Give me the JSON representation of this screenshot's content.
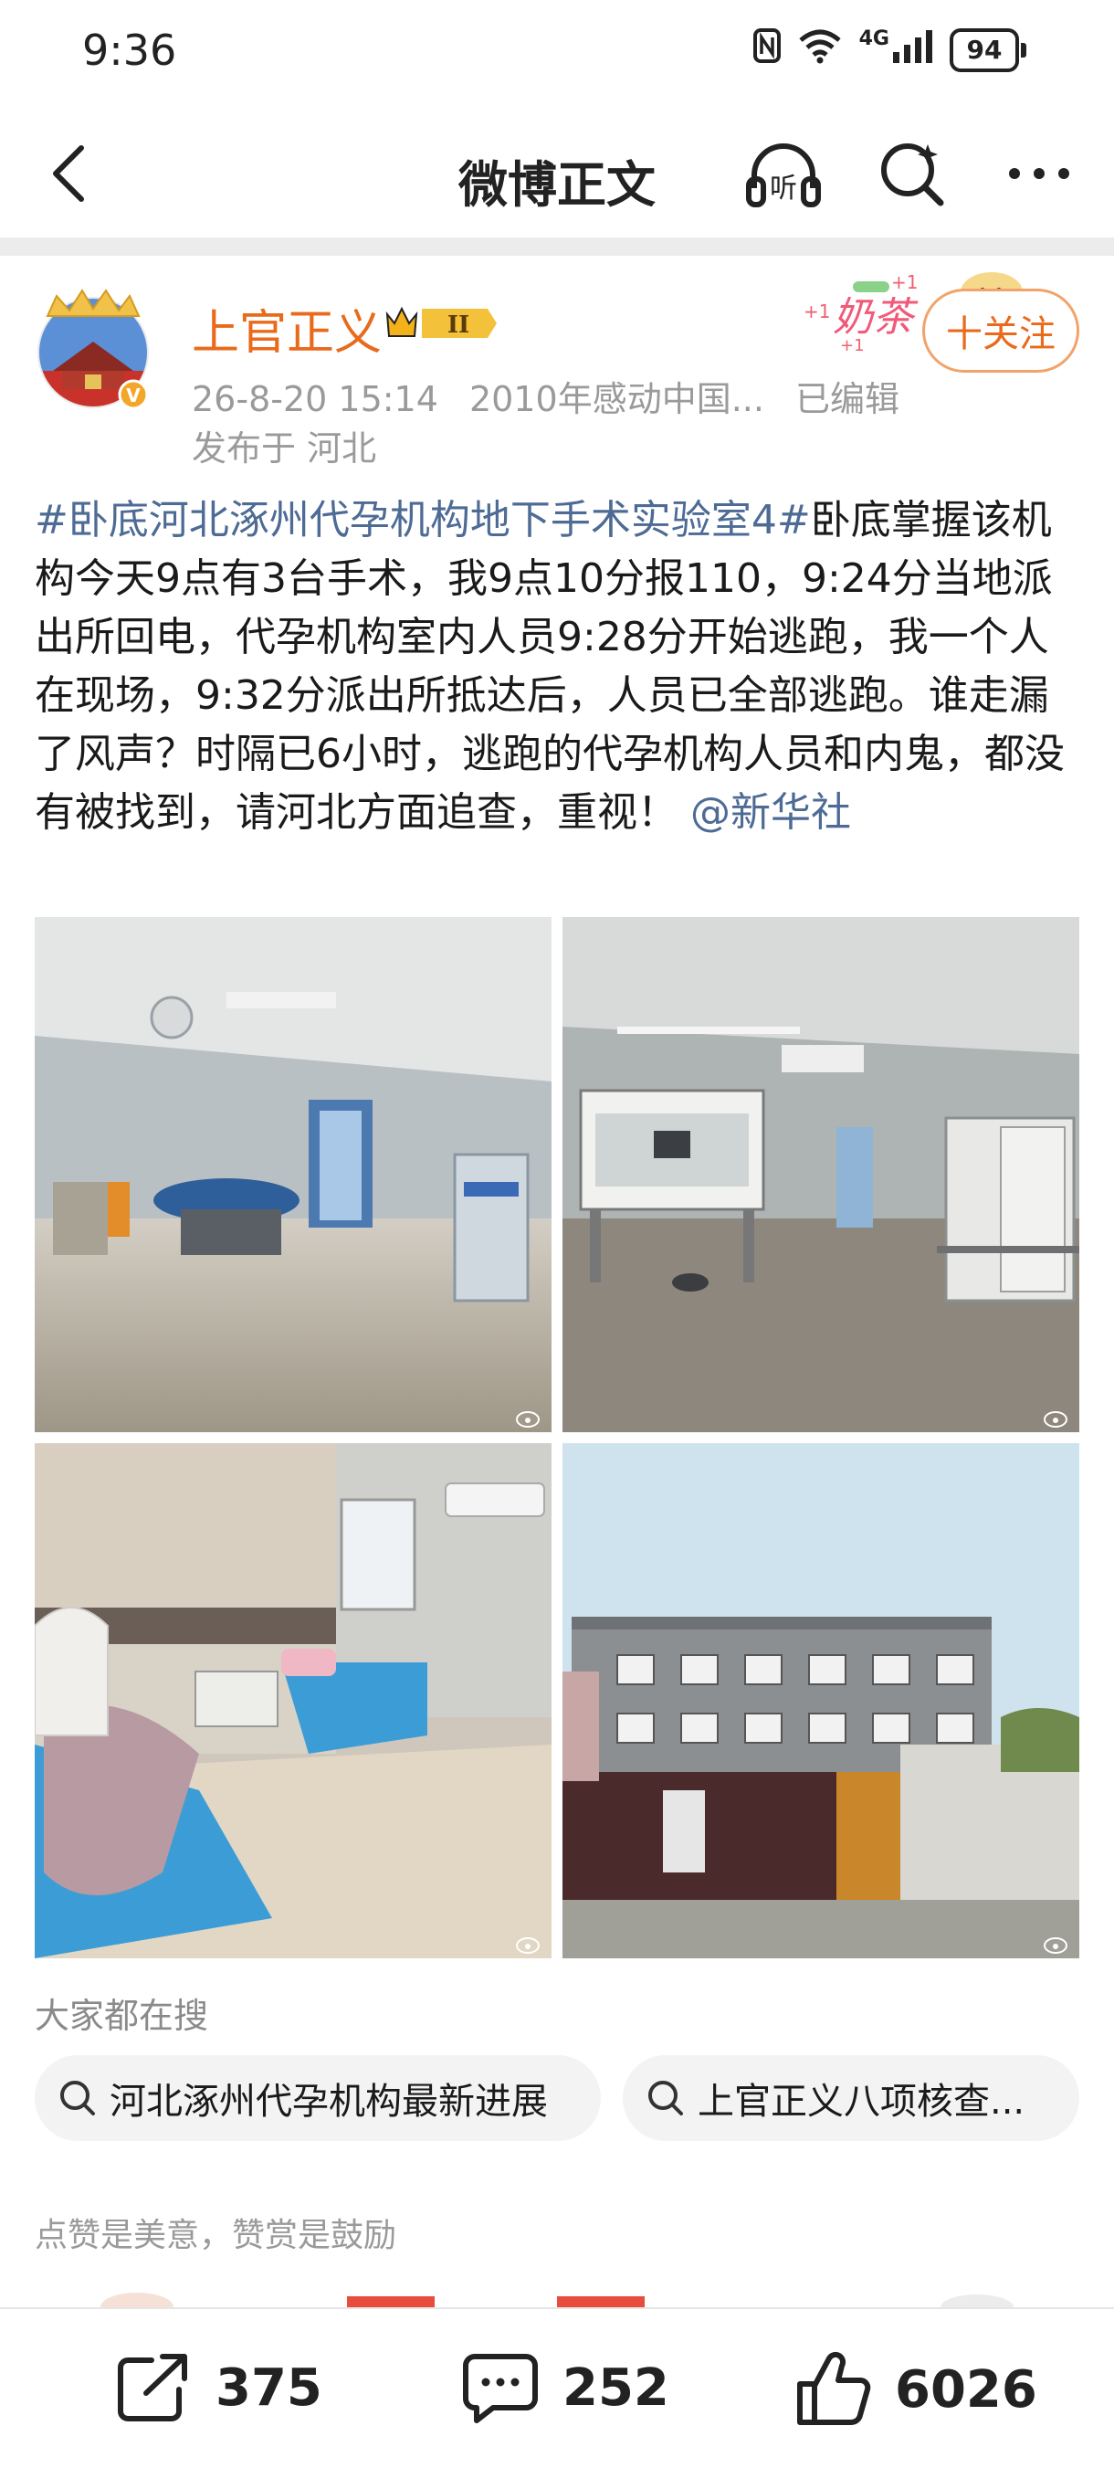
{
  "status": {
    "time": "9:36",
    "network": "4G",
    "battery": "94"
  },
  "nav": {
    "title": "微博正文"
  },
  "author": {
    "name": "上官正义",
    "level": "II",
    "follow_label": "十关注",
    "decor_text": "奶茶"
  },
  "post": {
    "date": "26-8-20 15:14",
    "source": "2010年感动中国...",
    "edited": "已编辑",
    "location": "发布于 河北",
    "hashtag": "#卧底河北涿州代孕机构地下手术实验室4#",
    "body": "卧底掌握该机构今天9点有3台手术，我9点10分报110，9:24分当地派出所回电，代孕机构室内人员9:28分开始逃跑，我一个人在现场，9:32分派出所抵达后，人员已全部逃跑。谁走漏了风声？时隔已6小时，逃跑的代孕机构人员和内鬼，都没有被找到，请河北方面追查，重视！",
    "mention": "@新华社"
  },
  "search": {
    "label": "大家都在搜",
    "chips": [
      "河北涿州代孕机构最新进展",
      "上官正义八项核查..."
    ]
  },
  "reward": {
    "label": "点赞是美意，赞赏是鼓励"
  },
  "actions": {
    "share": "375",
    "comment": "252",
    "like": "6026"
  },
  "colors": {
    "accent": "#ea6a1c",
    "link": "#4d6b95",
    "muted": "#9a9a9a"
  }
}
